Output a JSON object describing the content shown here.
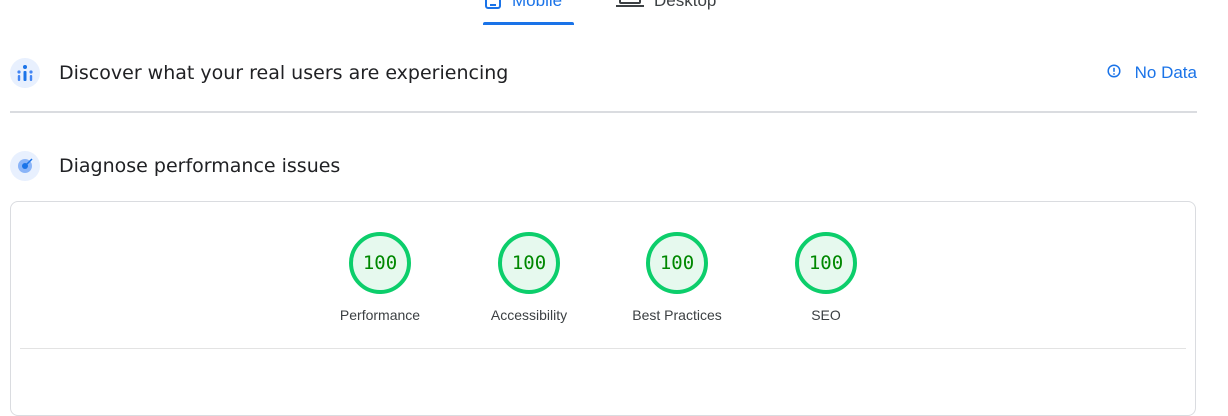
{
  "tabs": [
    {
      "label": "Mobile",
      "icon": "phone-icon",
      "active": true
    },
    {
      "label": "Desktop",
      "icon": "laptop-icon",
      "active": false
    }
  ],
  "field_data": {
    "title": "Discover what your real users are experiencing",
    "icon": "users-chart-icon",
    "status": "No Data",
    "status_icon": "info-icon"
  },
  "lab_data": {
    "title": "Diagnose performance issues",
    "icon": "target-icon",
    "scores": [
      {
        "label": "Performance",
        "value": "100"
      },
      {
        "label": "Accessibility",
        "value": "100"
      },
      {
        "label": "Best Practices",
        "value": "100"
      },
      {
        "label": "SEO",
        "value": "100"
      }
    ]
  },
  "colors": {
    "accent": "#1a73e8",
    "pass": "#0cce6b",
    "pass_text": "#008800",
    "pass_fill": "#e6f9ee"
  }
}
